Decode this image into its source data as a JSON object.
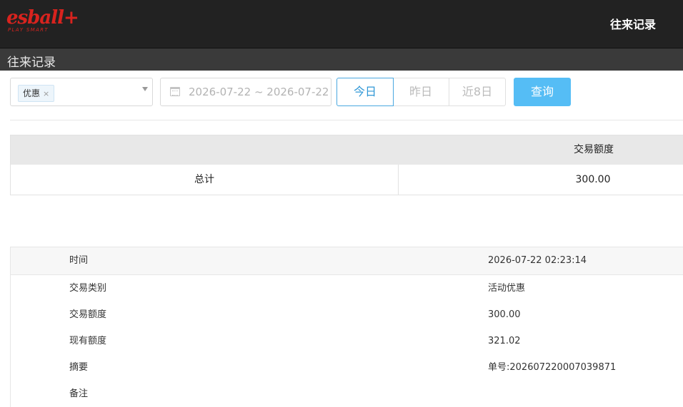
{
  "brand": {
    "logo_text": "esball+",
    "logo_tagline": "PLAY SMART",
    "logo_color": "#d8231e"
  },
  "header": {
    "title": "往来记录"
  },
  "subheader": {
    "title": "往来记录"
  },
  "filters": {
    "type_tag": "优惠",
    "type_tag_close": "×",
    "date_range": "2026-07-22 ~ 2026-07-22",
    "quick": {
      "today": "今日",
      "yesterday": "昨日",
      "last8": "近8日"
    },
    "query_label": "查询",
    "accent_color": "#55bdf5"
  },
  "summary": {
    "header_amount": "交易额度",
    "row_label": "总计",
    "row_amount": "300.00"
  },
  "detail": {
    "rows": [
      {
        "label": "时间",
        "value": "2026-07-22 02:23:14"
      },
      {
        "label": "交易类别",
        "value": "活动优惠"
      },
      {
        "label": "交易额度",
        "value": "300.00"
      },
      {
        "label": "现有额度",
        "value": "321.02"
      },
      {
        "label": "摘要",
        "value": "单号:202607220007039871"
      },
      {
        "label": "备注",
        "value": ""
      }
    ]
  }
}
